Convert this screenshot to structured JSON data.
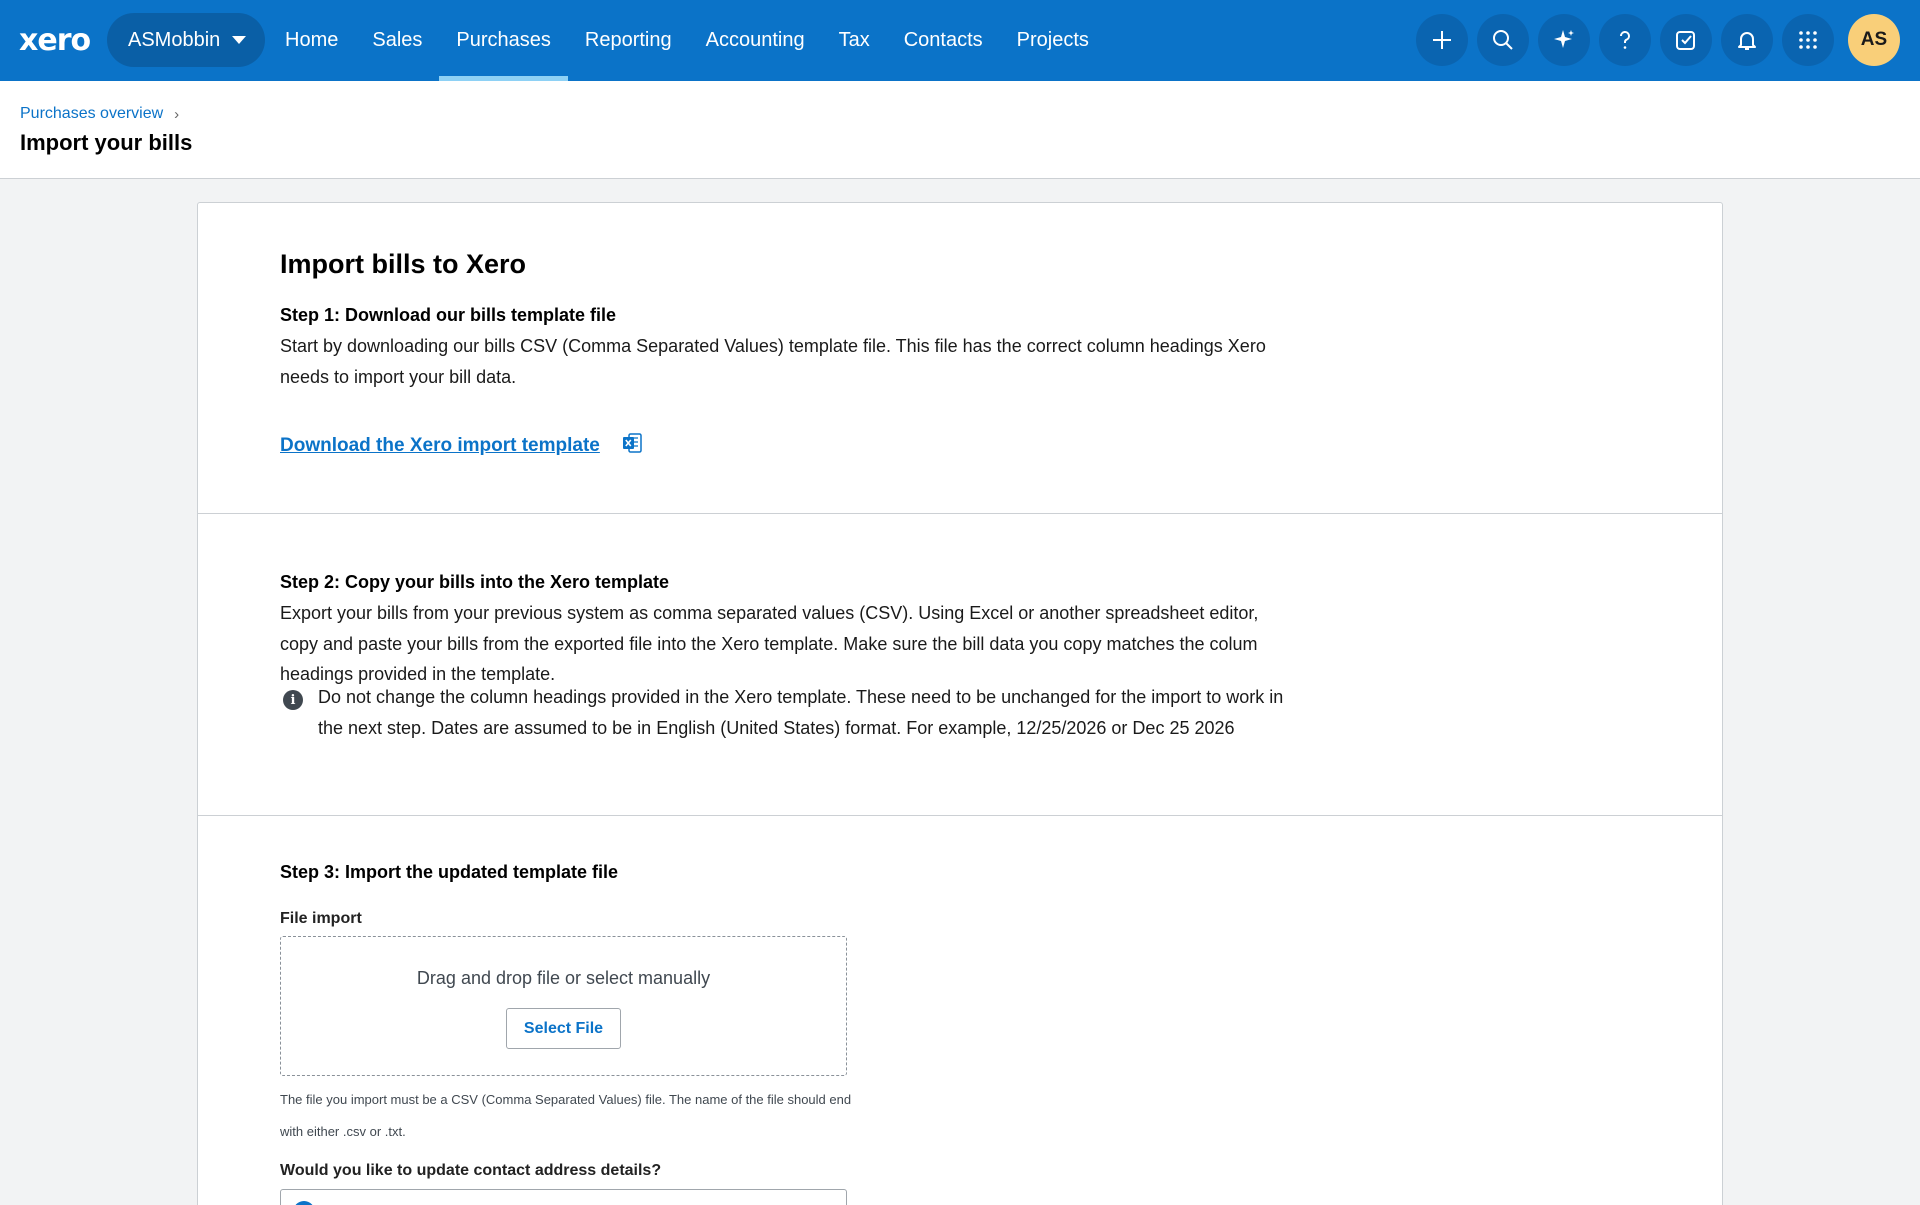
{
  "nav": {
    "logo": "xero",
    "org_name": "ASMobbin",
    "links": [
      "Home",
      "Sales",
      "Purchases",
      "Reporting",
      "Accounting",
      "Tax",
      "Contacts",
      "Projects"
    ],
    "active_link": "Purchases",
    "icons": [
      "plus-icon",
      "search-icon",
      "sparkle-icon",
      "help-icon",
      "tasks-icon",
      "bell-icon",
      "apps-grid-icon"
    ],
    "avatar_initials": "AS"
  },
  "header": {
    "breadcrumb": "Purchases overview",
    "title": "Import your bills"
  },
  "card": {
    "title": "Import bills to Xero",
    "step1": {
      "heading": "Step 1: Download our bills template file",
      "text": "Start by downloading our bills CSV (Comma Separated Values) template file. This file has the correct column headings Xero needs to import your bill data.",
      "link": "Download the Xero import template"
    },
    "step2": {
      "heading": "Step 2: Copy your bills into the Xero template",
      "text": "Export your bills from your previous system as comma separated values (CSV). Using Excel or another spreadsheet editor, copy and paste your bills from the exported file into the Xero template. Make sure the bill data you copy matches the colum headings provided in the template.",
      "info": "Do not change the column headings provided in the Xero template. These need to be unchanged for the import to work in the next step. Dates are assumed to be in English (United States) format. For example, 12/25/2026 or Dec 25 2026"
    },
    "step3": {
      "heading": "Step 3: Import the updated template file",
      "file_label": "File import",
      "dropzone_text": "Drag and drop file or select manually",
      "select_button": "Select File",
      "hint": "The file you import must be a CSV (Comma Separated Values) file. The name of the file should end with either .csv or .txt.",
      "contact_question": "Would you like to update contact address details?"
    }
  },
  "colors": {
    "nav_bg": "#0b73c8",
    "link": "#0b73c8",
    "avatar_bg": "#f9cf79"
  }
}
